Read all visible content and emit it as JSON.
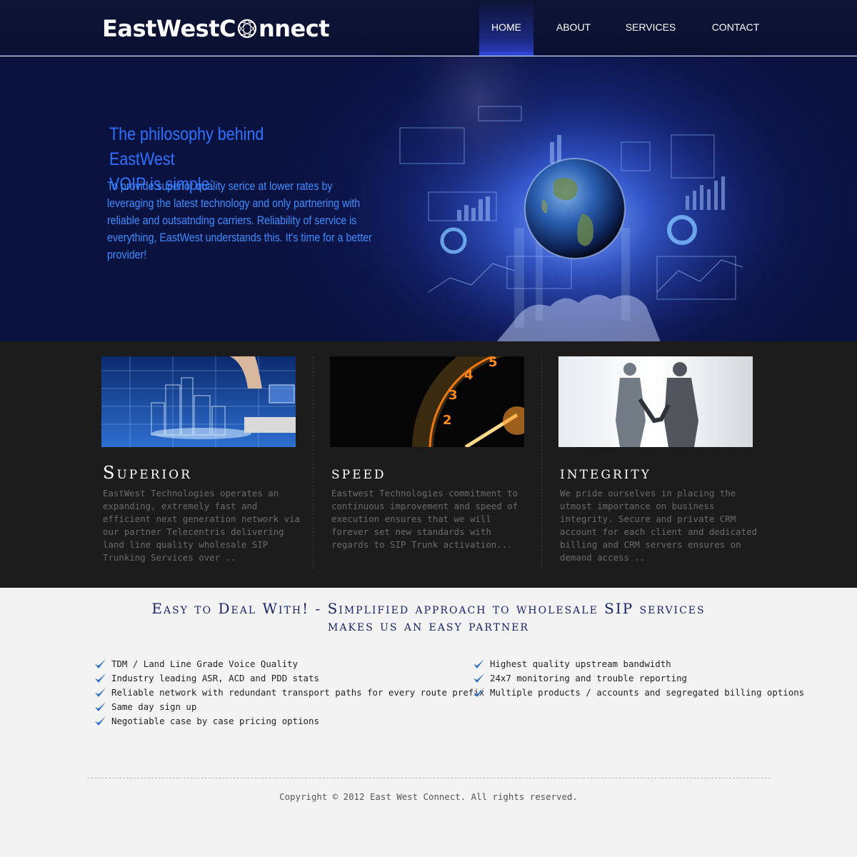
{
  "header": {
    "logo_part1": "EastWestC",
    "logo_part2": "nnect",
    "nav": [
      {
        "label": "HOME",
        "active": true
      },
      {
        "label": "ABOUT",
        "active": false
      },
      {
        "label": "SERVICES",
        "active": false
      },
      {
        "label": "CONTACT",
        "active": false
      }
    ]
  },
  "hero": {
    "title_line1": "The philosophy behind EastWest",
    "title_line2": "VOIP is simple:",
    "body": "To provide superior quality serice at lower rates by leveraging the latest technology and only partnering with reliable and outsatnding carriers. Reliability of service is everything, EastWest understands this. It's time for a better provider!"
  },
  "features": [
    {
      "title": "Superior",
      "text": "EastWest Technologies operates an expanding, extremely fast and efficient next generation network via our partner Telecentris delivering land line quality wholesale SIP Trunking Services over .."
    },
    {
      "title": "speed",
      "text": "Eastwest Technologies commitment to continuous improvement and speed of execution ensures that we will forever set new standards with regards to SIP Trunk activation..."
    },
    {
      "title": "integrity",
      "text": "We pride ourselves in placing the utmost importance on business integrity. Secure and private CRM account for each client and dedicated billing and CRM servers ensures on demand access .."
    }
  ],
  "easy": {
    "title_line1": "Easy to Deal With! - Simplified approach to wholesale SIP services",
    "title_line2": "makes us an easy partner",
    "left_items": [
      "TDM / Land Line Grade Voice Quality",
      "Industry leading ASR, ACD and PDD stats",
      "Reliable network with redundant transport paths for every route prefix",
      "Same day sign up",
      "Negotiable case by case pricing options"
    ],
    "right_items": [
      "Highest quality upstream bandwidth",
      "24x7 monitoring and trouble reporting",
      "Multiple products / accounts and segregated billing options"
    ]
  },
  "footer": {
    "copyright": "Copyright © 2012 East West Connect. All rights reserved."
  },
  "colors": {
    "header_bg": "#0e1436",
    "accent_blue": "#2f72ff",
    "features_bg": "#1c1c1c",
    "heading_navy": "#1a2466",
    "check_blue": "#2a6fc8"
  }
}
